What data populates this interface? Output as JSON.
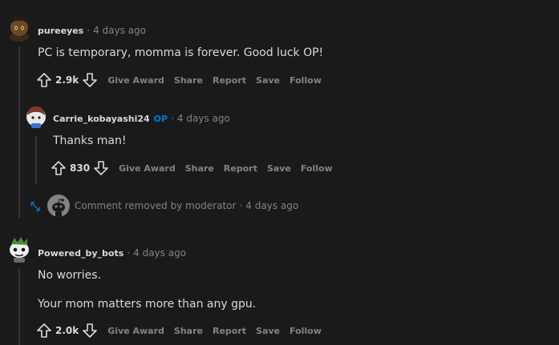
{
  "comments": [
    {
      "username": "pureeyes",
      "time": "4 days ago",
      "body": [
        "PC is temporary, momma is forever. Good luck OP!"
      ],
      "score": "2.9k"
    },
    {
      "username": "Carrie_kobayashi24",
      "op_tag": "OP",
      "time": "4 days ago",
      "body": [
        "Thanks man!"
      ],
      "score": "830"
    },
    {
      "removed_text": "Comment removed by moderator",
      "time": "4 days ago"
    },
    {
      "username": "Powered_by_bots",
      "time": "4 days ago",
      "body": [
        "No worries.",
        "Your mom matters more than any gpu."
      ],
      "score": "2.0k"
    }
  ],
  "actions": {
    "give_award": "Give Award",
    "share": "Share",
    "report": "Report",
    "save": "Save",
    "follow": "Follow"
  },
  "separator": "·",
  "icons": {
    "upvote": "upvote-arrow-icon",
    "downvote": "downvote-arrow-icon",
    "expand": "expand-thread-icon"
  },
  "colors": {
    "background": "#1a1a1b",
    "text": "#d7dadc",
    "muted": "#818384",
    "op_blue": "#0079d3",
    "thread_line": "#343536"
  }
}
